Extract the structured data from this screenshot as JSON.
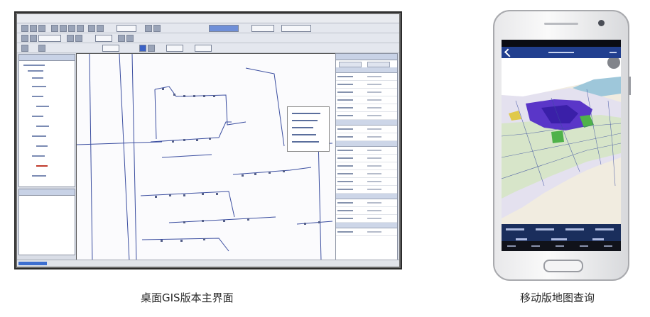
{
  "desktop": {
    "caption": "桌面GIS版本主界面",
    "menus": [
      "",
      "",
      "",
      "",
      "",
      "",
      "",
      "",
      "",
      "",
      "",
      "",
      ""
    ]
  },
  "mobile": {
    "caption": "移动版地图查询"
  },
  "colors": {
    "app_bar": "#213f8f",
    "map_water": "#9ec7da",
    "map_density": "#5a36c8",
    "map_green": "#4fb24a",
    "map_line": "#3b4ea0"
  }
}
